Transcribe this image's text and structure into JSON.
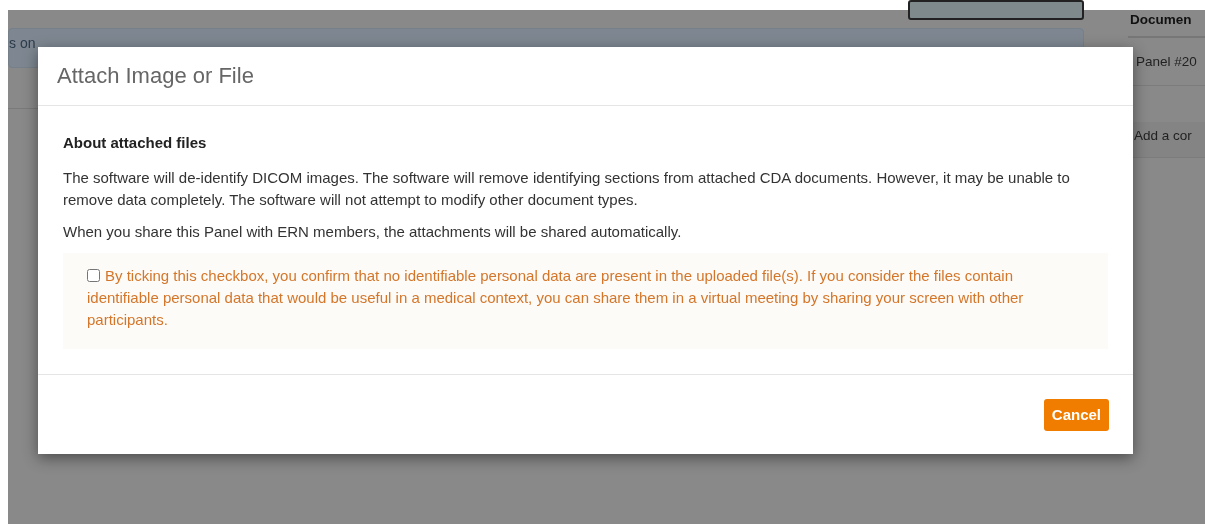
{
  "background": {
    "notice_text": "s on",
    "side_heading": "Documen",
    "side_item": "Panel #20",
    "side_comment": "Add a cor"
  },
  "modal": {
    "title": "Attach Image or File",
    "section_heading": "About attached files",
    "paragraphs": [
      "The software will de-identify DICOM images. The software will remove identifying sections from attached CDA documents. However, it may be unable to remove data completely. The software will not attempt to modify other document types.",
      "When you share this Panel with ERN members, the attachments will be shared automatically."
    ],
    "consent": {
      "checked": false,
      "label": "By ticking this checkbox, you confirm that no identifiable personal data are present in the uploaded file(s). If you consider the files contain identifiable personal data that would be useful in a medical context, you can share them in a virtual meeting by sharing your screen with other participants."
    },
    "buttons": [
      "Cancel"
    ]
  }
}
